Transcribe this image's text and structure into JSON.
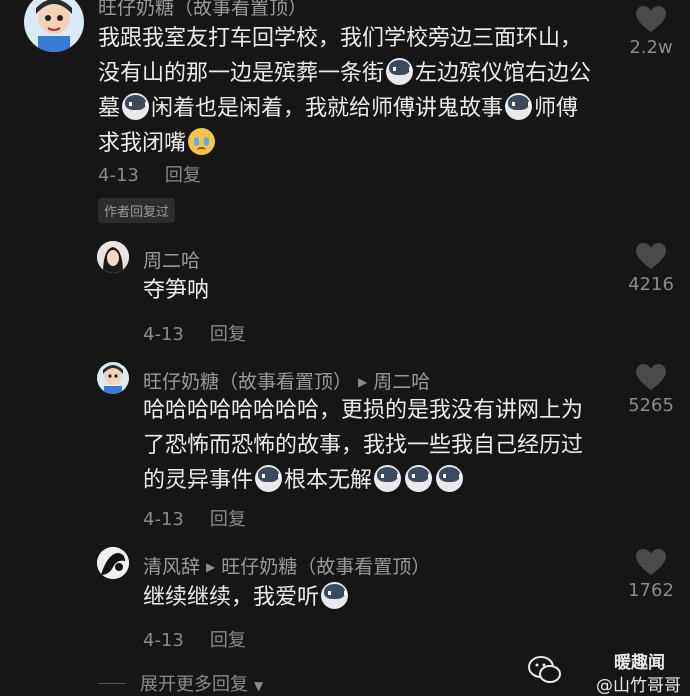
{
  "comments": [
    {
      "author": "旺仔奶糖（故事看置顶）",
      "text_parts": [
        "我跟我室友打车回学校，我们学校旁边三面环山，没有山的那一边是殡葬一条街",
        "左边殡仪馆右边公墓",
        "闲着也是闲着，我就给师傅讲鬼故事",
        "师傅求我闭嘴"
      ],
      "emojis": [
        "dog-emoji",
        "dog-emoji",
        "dog-emoji",
        "crying-emoji"
      ],
      "date": "4-13",
      "reply_label": "回复",
      "likes": "2.2w",
      "badge": "作者回复过"
    },
    {
      "author": "周二哈",
      "text": "夺笋呐",
      "date": "4-13",
      "reply_label": "回复",
      "likes": "4216"
    },
    {
      "author": "旺仔奶糖（故事看置顶）",
      "reply_to": "周二哈",
      "text_line1": "哈哈哈哈哈哈哈哈，更损的是我没有讲网上为了恐怖而恐怖的故事，我找一些我自己经",
      "text_line2a": "历过的灵异事件",
      "text_line2b": "根本无解",
      "date": "4-13",
      "reply_label": "回复",
      "likes": "5265"
    },
    {
      "author": "清风辞",
      "reply_to": "旺仔奶糖（故事看置顶）",
      "text": "继续继续，我爱听",
      "date": "4-13",
      "reply_label": "回复",
      "likes": "1762"
    }
  ],
  "expand_label": "展开更多回复",
  "watermark": {
    "line1": "暖趣闻",
    "line2": "@山竹哥哥"
  },
  "colors": {
    "background": "#161616",
    "text": "#ececec",
    "muted": "#8a8a8a"
  }
}
